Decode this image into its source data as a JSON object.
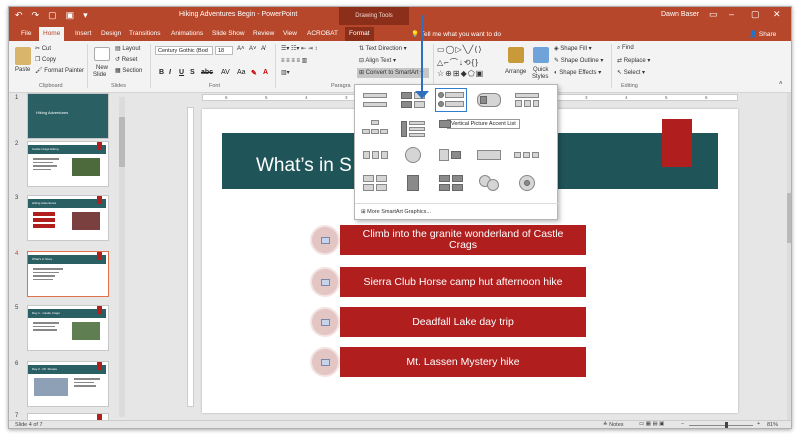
{
  "title_bar": {
    "doc_title": "Hiking Adventures Begin - PowerPoint",
    "context_group": "Drawing Tools",
    "user": "Dawn Baser"
  },
  "tabs": [
    "File",
    "Home",
    "Insert",
    "Design",
    "Transitions",
    "Animations",
    "Slide Show",
    "Review",
    "View",
    "ACROBAT",
    "Format"
  ],
  "tell_me": "Tell me what you want to do",
  "share": "Share",
  "ribbon": {
    "clipboard": {
      "paste": "Paste",
      "cut": "Cut",
      "copy": "Copy",
      "format_painter": "Format Painter",
      "label": "Clipboard"
    },
    "slides": {
      "new_slide": "New",
      "new_slide2": "Slide",
      "layout": "Layout",
      "reset": "Reset",
      "section": "Section",
      "label": "Slides"
    },
    "font": {
      "family": "Century Gothic (Bod",
      "size": "18",
      "label": "Font"
    },
    "paragraph": {
      "label": "Paragra",
      "text_direction": "Text Direction",
      "align_text": "Align Text",
      "convert": "Convert to SmartArt"
    },
    "drawing": {
      "arrange": "Arrange",
      "quick": "Quick",
      "styles": "Styles",
      "shape_fill": "Shape Fill",
      "shape_outline": "Shape Outline",
      "shape_effects": "Shape Effects"
    },
    "editing": {
      "find": "Find",
      "replace": "Replace",
      "select": "Select",
      "label": "Editing"
    }
  },
  "thumbnails": [
    {
      "num": "1",
      "title": "Hiking Adventures"
    },
    {
      "num": "2",
      "title": "Castle Crags Hiking"
    },
    {
      "num": "3",
      "title": "Hiking Adventures"
    },
    {
      "num": "4",
      "title": "What's in Store"
    },
    {
      "num": "5",
      "title": "Day 1 - Castle Crags"
    },
    {
      "num": "6",
      "title": "Day 2 - Mt. Shasta"
    },
    {
      "num": "7",
      "title": ""
    }
  ],
  "slide": {
    "title": "What’s in S",
    "bullets": [
      "Climb into the granite wonderland of Castle Crags",
      "Sierra Club Horse camp hut afternoon hike",
      "Deadfall Lake day trip",
      "Mt. Lassen Mystery hike"
    ]
  },
  "gallery": {
    "tooltip": "Vertical Picture Accent List",
    "more": "More SmartArt Graphics..."
  },
  "ruler_ticks": [
    "6",
    "5",
    "4",
    "3",
    "2",
    "1",
    "0",
    "1",
    "2",
    "3",
    "4",
    "5",
    "6"
  ],
  "status": {
    "slide": "Slide 4 of 7",
    "notes": "Notes",
    "zoom": "81%"
  }
}
